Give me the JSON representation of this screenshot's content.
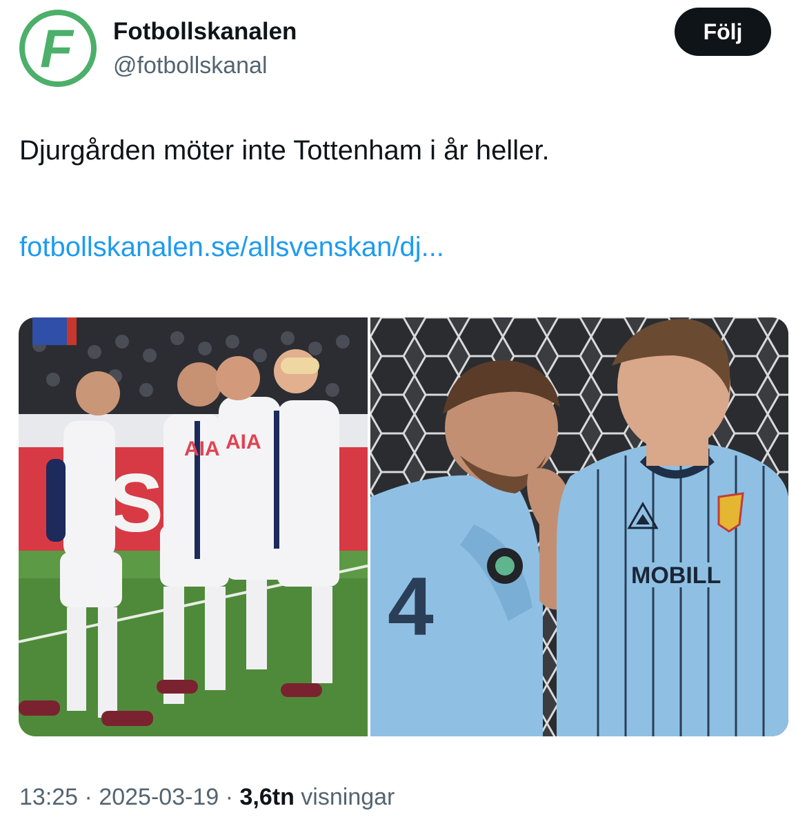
{
  "author": {
    "display_name": "Fotbollskanalen",
    "handle": "@fotbollskanal",
    "avatar_letter": "F",
    "avatar_color": "#4caf6a"
  },
  "follow_button": {
    "label": "Följ"
  },
  "tweet": {
    "text": "Djurgården möter inte Tottenham i år heller.",
    "link": "fotbollskanalen.se/allsvenskan/dj..."
  },
  "media": [
    {
      "icon": "photo-tottenham-players-celebrating",
      "shirt_text": "AIA"
    },
    {
      "icon": "photo-djurgarden-players-talking",
      "shirt_text": "MOBILL"
    }
  ],
  "meta": {
    "time": "13:25",
    "separator": "·",
    "date": "2025-03-19",
    "views_count": "3,6tn",
    "views_label": "visningar"
  },
  "colors": {
    "link": "#1d9bf0",
    "text": "#0f1419",
    "secondary": "#536471",
    "button_bg": "#0f1419"
  }
}
